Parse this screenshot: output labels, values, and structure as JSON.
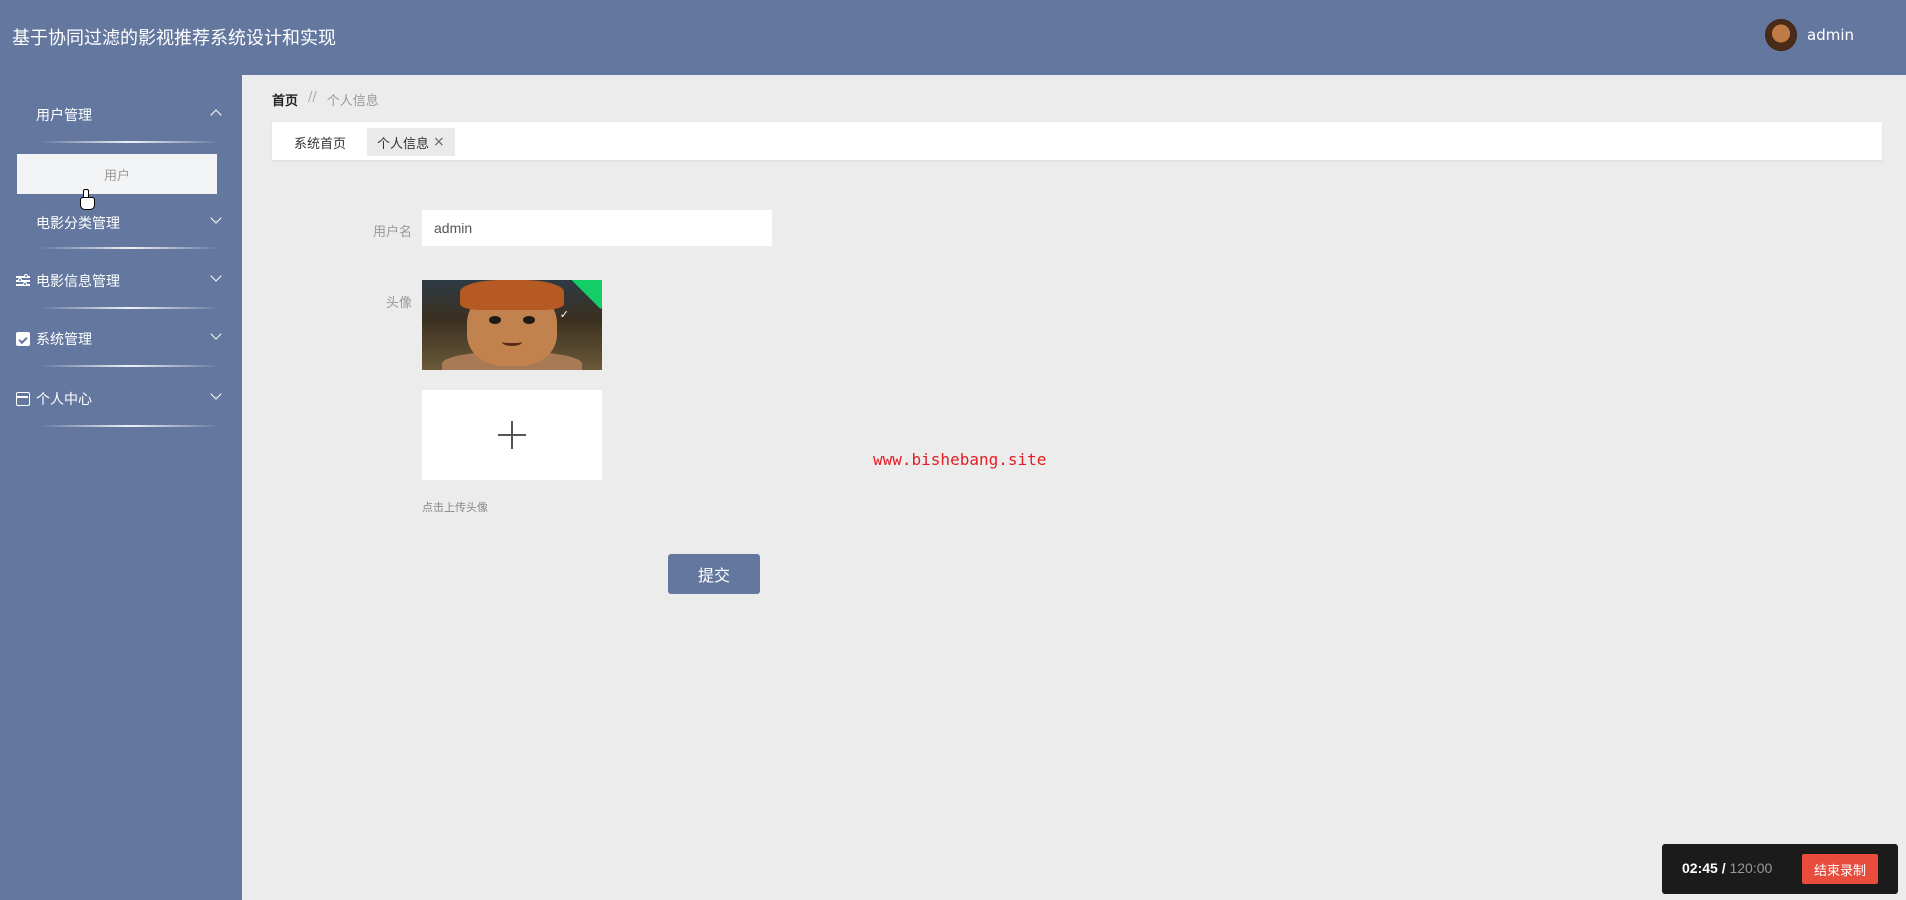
{
  "header": {
    "title": "基于协同过滤的影视推荐系统设计和实现",
    "user_name": "admin"
  },
  "sidebar": {
    "items": [
      {
        "label": "用户管理",
        "icon": "grid-icon",
        "expanded": true
      },
      {
        "label": "电影分类管理",
        "icon": "grid-icon",
        "expanded": false
      },
      {
        "label": "电影信息管理",
        "icon": "sliders-icon",
        "expanded": false
      },
      {
        "label": "系统管理",
        "icon": "clipboard-check-icon",
        "expanded": false
      },
      {
        "label": "个人中心",
        "icon": "card-icon",
        "expanded": false
      }
    ],
    "submenu": {
      "label": "用户"
    }
  },
  "breadcrumb": {
    "home": "首页",
    "separator": "//",
    "current": "个人信息"
  },
  "tabs": [
    {
      "label": "系统首页"
    },
    {
      "label": "个人信息",
      "close": "×"
    }
  ],
  "form": {
    "username_label": "用户名",
    "username_value": "admin",
    "avatar_label": "头像",
    "upload_tip": "点击上传头像",
    "submit_label": "提交"
  },
  "watermark": "www.bishebang.site",
  "recording": {
    "elapsed": "02:45 /",
    "total": " 120:00",
    "stop_label": "结束录制"
  },
  "colors": {
    "primary": "#64789f",
    "background": "#ececec",
    "success": "#13ce66",
    "danger": "#e74c3c"
  }
}
